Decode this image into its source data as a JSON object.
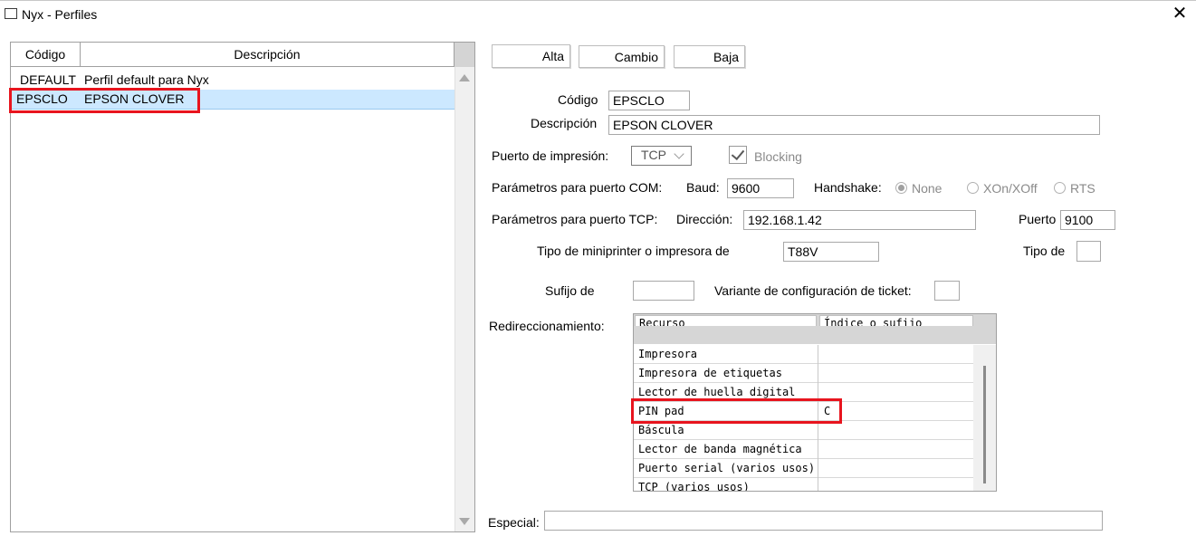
{
  "window": {
    "title": "Nyx - Perfiles",
    "close_symbol": "✕"
  },
  "profiles_grid": {
    "columns": [
      "Código",
      "Descripción"
    ],
    "rows": [
      {
        "codigo": "DEFAULT",
        "descripcion": "Perfil default para Nyx"
      },
      {
        "codigo": "EPSCLO",
        "descripcion": "EPSON CLOVER"
      }
    ],
    "selected_index": 1
  },
  "toolbar": {
    "alta_label": "Alta",
    "cambio_label": "Cambio",
    "baja_label": "Baja"
  },
  "form": {
    "codigo_label": "Código",
    "codigo_value": "EPSCLO",
    "descripcion_label": "Descripción",
    "descripcion_value": "EPSON CLOVER",
    "puerto_label": "Puerto de impresión:",
    "puerto_value": "TCP",
    "blocking_label": "Blocking",
    "blocking_checked": true,
    "com_label": "Parámetros para puerto COM:",
    "baud_label": "Baud:",
    "baud_value": "9600",
    "handshake_label": "Handshake:",
    "handshake_options": [
      "None",
      "XOn/XOff",
      "RTS"
    ],
    "handshake_selected": "None",
    "tcp_label": "Parámetros para puerto TCP:",
    "direccion_label": "Dirección:",
    "direccion_value": "192.168.1.42",
    "puerto_tcp_label": "Puerto",
    "puerto_tcp_value": "9100",
    "tipo_mini_label": "Tipo de miniprinter o impresora de",
    "tipo_mini_value": "T88V",
    "tipo_de_label": "Tipo de",
    "tipo_de_value": "",
    "sufijo_label": "Sufijo de",
    "sufijo_value": "",
    "variante_label": "Variante de configuración de ticket:",
    "variante_value": "",
    "redireccion_label": "Redireccionamiento:",
    "especial_label": "Especial:",
    "especial_value": ""
  },
  "redirect_table": {
    "columns": [
      "Recurso",
      "Índice o sufijo"
    ],
    "rows": [
      {
        "recurso": "",
        "indice": ""
      },
      {
        "recurso": "Impresora",
        "indice": ""
      },
      {
        "recurso": "Impresora de etiquetas",
        "indice": ""
      },
      {
        "recurso": "Lector de huella digital",
        "indice": ""
      },
      {
        "recurso": "PIN pad",
        "indice": "C"
      },
      {
        "recurso": "Báscula",
        "indice": ""
      },
      {
        "recurso": "Lector de banda magnética",
        "indice": ""
      },
      {
        "recurso": "Puerto serial (varios usos)",
        "indice": ""
      },
      {
        "recurso": "TCP (varios usos)",
        "indice": ""
      }
    ]
  },
  "colors": {
    "highlight_red": "#e8141e",
    "selection_blue": "#cce8ff"
  }
}
